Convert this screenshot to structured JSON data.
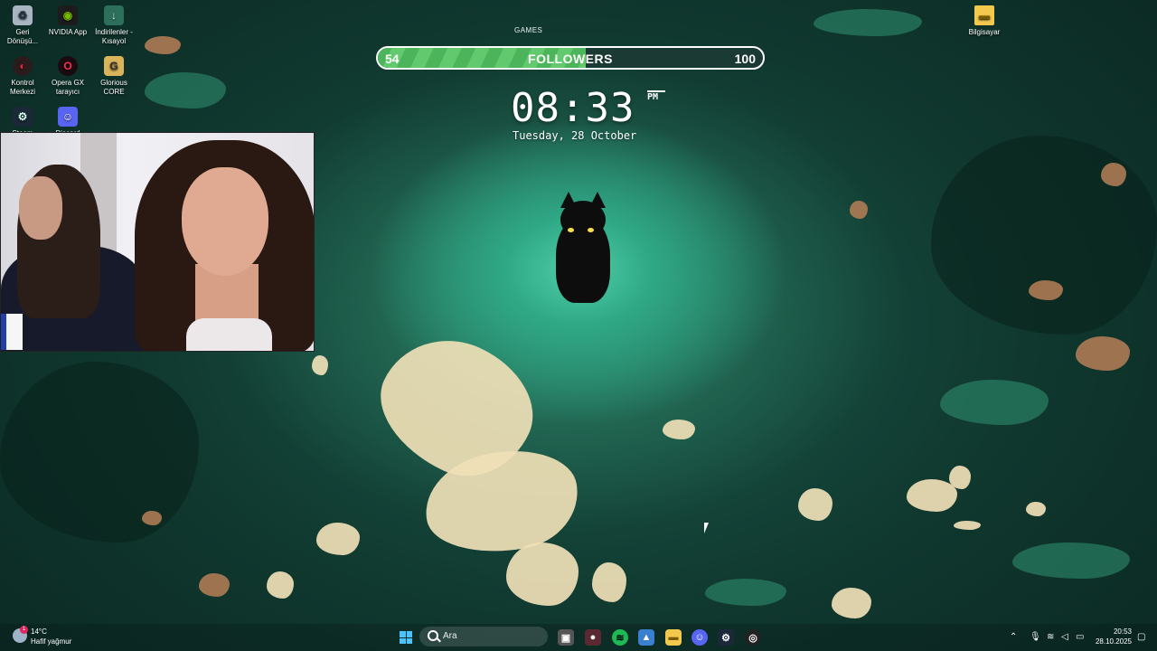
{
  "desktop": {
    "icons_left": [
      {
        "label": "Geri Dönüşü...",
        "icon": "recycle-bin-icon"
      },
      {
        "label": "NVIDIA App",
        "icon": "nvidia-icon"
      },
      {
        "label": "İndirilenler - Kısayol",
        "icon": "downloads-icon"
      },
      {
        "label": "Kontrol Merkezi",
        "icon": "control-center-icon"
      },
      {
        "label": "Opera GX tarayıcı",
        "icon": "opera-gx-icon"
      },
      {
        "label": "Glorious CORE",
        "icon": "glorious-icon"
      },
      {
        "label": "Steam",
        "icon": "steam-icon"
      },
      {
        "label": "Discord",
        "icon": "discord-icon"
      }
    ],
    "icon_right": {
      "label": "Bilgisayar",
      "icon": "folder-icon"
    }
  },
  "widget": {
    "games_label": "GAMES",
    "followers": {
      "current_label": "54",
      "label": "FOLLOWERS",
      "goal_label": "100",
      "current": 54,
      "goal": 100
    },
    "clock": "08:33",
    "ampm": "PM",
    "date": "Tuesday, 28 October"
  },
  "taskbar": {
    "weather": {
      "temp": "14°C",
      "desc": "Hafif yağmur",
      "badge": "1"
    },
    "search_placeholder": "Ara",
    "apps": [
      "windows-start-icon",
      "file-explorer-icon",
      "task-view-icon",
      "spotify-icon",
      "photos-icon",
      "folder-icon",
      "discord-icon",
      "steam-icon",
      "obs-icon"
    ],
    "tray": {
      "time": "20:53",
      "date": "28.10.2025"
    }
  },
  "colors": {
    "accent_green": "#4cb45a",
    "wallpaper_dark": "#10382f",
    "wallpaper_light": "#4fd0a8",
    "cream": "#efe0b6"
  }
}
